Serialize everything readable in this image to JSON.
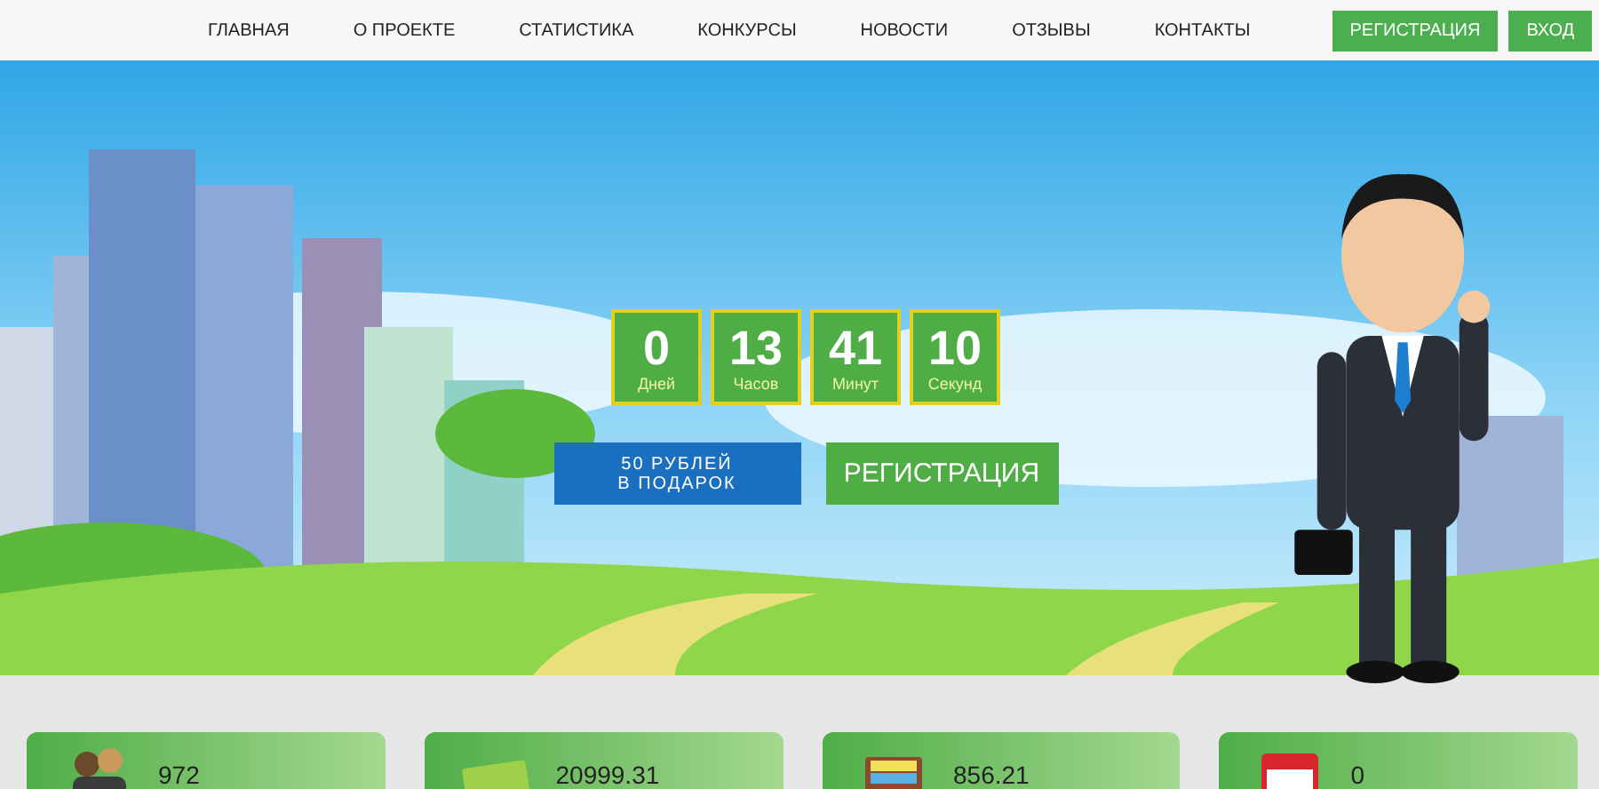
{
  "nav": {
    "items": [
      {
        "label": "ГЛАВНАЯ"
      },
      {
        "label": "О ПРОЕКТЕ"
      },
      {
        "label": "СТАТИСТИКА"
      },
      {
        "label": "КОНКУРСЫ"
      },
      {
        "label": "НОВОСТИ"
      },
      {
        "label": "ОТЗЫВЫ"
      },
      {
        "label": "КОНТАКТЫ"
      }
    ],
    "buttons": [
      "РЕГИСТРАЦИЯ",
      "ВХОД"
    ]
  },
  "hero": {
    "countdown": [
      {
        "value": "0",
        "unit": "Дней"
      },
      {
        "value": "13",
        "unit": "Часов"
      },
      {
        "value": "41",
        "unit": "Минут"
      },
      {
        "value": "10",
        "unit": "Секунд"
      }
    ],
    "bonus_button": [
      "50 РУБЛЕЙ",
      "В ПОДАРОК"
    ],
    "register_button": "РЕГИСТРАЦИЯ"
  },
  "stats": [
    {
      "kind": "users",
      "value": "972"
    },
    {
      "kind": "money",
      "value": "20999.31"
    },
    {
      "kind": "payments",
      "value": "856.21"
    },
    {
      "kind": "calendar",
      "value": "0"
    }
  ]
}
